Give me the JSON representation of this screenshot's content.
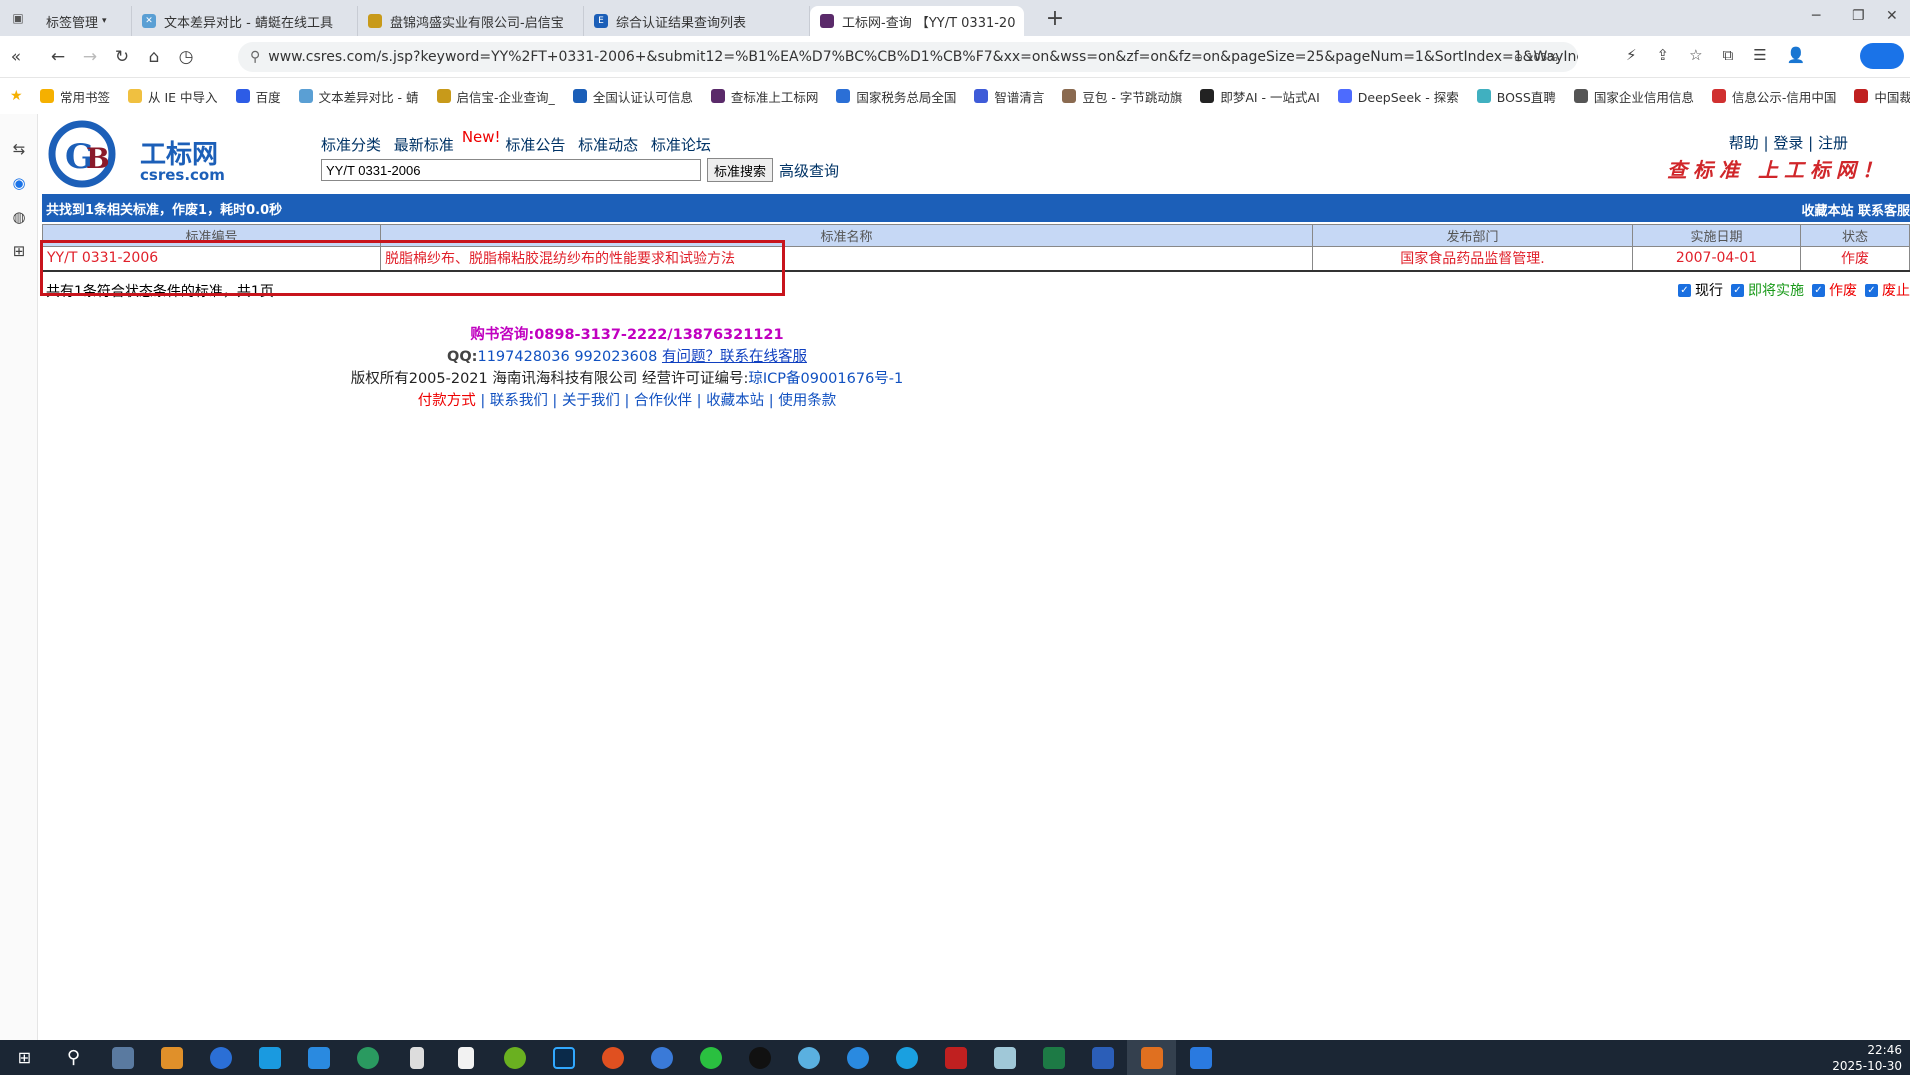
{
  "browser": {
    "tabs": [
      {
        "label": "标签管理",
        "icon": "tab-manager-icon"
      },
      {
        "label": "文本差异对比 - 蜻蜓在线工具",
        "icon": "dragonfly-icon"
      },
      {
        "label": "盘锦鸿盛实业有限公司-启信宝",
        "icon": "shield-icon"
      },
      {
        "label": "综合认证结果查询列表",
        "icon": "cert-icon"
      },
      {
        "label": "工标网-查询 【YY/T 0331-20",
        "icon": "csres-icon",
        "active": true
      }
    ],
    "url": "www.csres.com/s.jsp?keyword=YY%2FT+0331-2006+&submit12=%B1%EA%D7%BC%CB%D1%CB%F7&xx=on&wss=on&zf=on&fz=on&pageSize=25&pageNum=1&SortIndex=1&WayInde",
    "zoom": "105%",
    "bookmarks": [
      "常用书签",
      "从 IE 中导入",
      "百度",
      "文本差异对比 - 蜻",
      "启信宝-企业查询_",
      "全国认证认可信息",
      "查标准上工标网",
      "国家税务总局全国",
      "智谱清言",
      "豆包 - 字节跳动旗",
      "即梦AI - 一站式AI",
      "DeepSeek - 探索",
      "BOSS直聘",
      "国家企业信用信息",
      "信息公示-信用中国",
      "中国裁判文书网"
    ]
  },
  "site": {
    "logo_text": "工标网",
    "logo_domain": "csres.com",
    "nav": [
      "标准分类",
      "最新标准",
      "标准公告",
      "标准动态",
      "标准论坛"
    ],
    "new_badge": "New!",
    "search_value": "YY/T 0331-2006",
    "search_button": "标准搜索",
    "advanced": "高级查询",
    "help": "帮助",
    "login": "登录",
    "register": "注册",
    "slogan": "查标准 上工标网！",
    "summary": "共找到1条相关标准，作废1，耗时0.0秒",
    "bar_right": "收藏本站  联系客服",
    "columns": [
      "标准编号",
      "标准名称",
      "发布部门",
      "实施日期",
      "状态"
    ],
    "rows": [
      {
        "code": "YY/T 0331-2006",
        "name": "脱脂棉纱布、脱脂棉粘胶混纺纱布的性能要求和试验方法",
        "dept": "国家食品药品监督管理.",
        "date": "2007-04-01",
        "status": "作废"
      }
    ],
    "count_text": "共有1条符合状态条件的标准，共1页",
    "filters": [
      "现行",
      "即将实施",
      "作废",
      "废止"
    ],
    "filter_colors": [
      "#000000",
      "#1a9a1a",
      "#e00000",
      "#e00000"
    ],
    "footer": {
      "buy": "购书咨询:0898-3137-2222/13876321121",
      "qq_label": "QQ:",
      "qq": "1197428036 992023608",
      "qq_link": "有问题？联系在线客服",
      "copyright": "版权所有2005-2021 海南讯海科技有限公司 经营许可证编号:",
      "icp": "琼ICP备09001676号-1",
      "links": [
        "付款方式",
        "联系我们",
        "关于我们",
        "合作伙伴",
        "收藏本站",
        "使用条款"
      ]
    }
  },
  "taskbar": {
    "time": "22:46",
    "date": "2025-10-30"
  }
}
